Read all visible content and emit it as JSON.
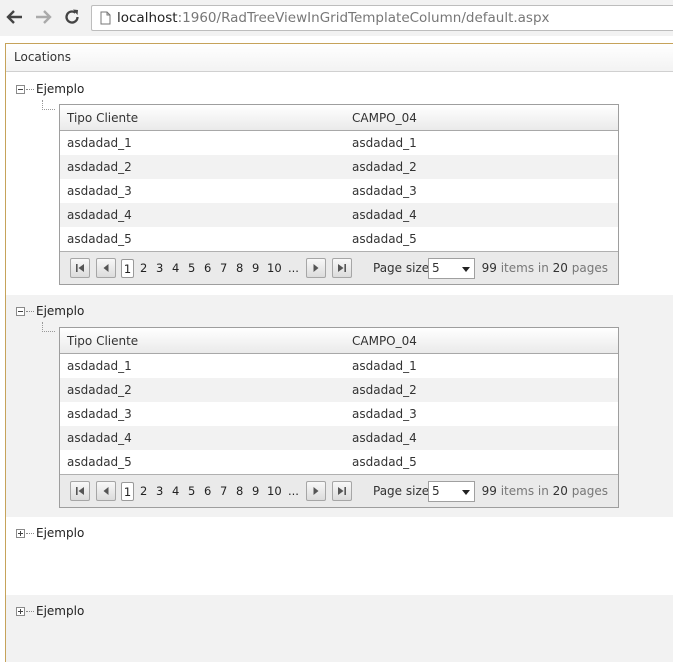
{
  "browser": {
    "url_host": "localhost",
    "url_rest": ":1960/RadTreeViewInGridTemplateColumn/default.aspx"
  },
  "outer_grid": {
    "header": "Locations"
  },
  "rows": [
    {
      "node_label": "Ejemplo",
      "expanded": true,
      "grid": {
        "columns": [
          "Tipo Cliente",
          "CAMPO_04"
        ],
        "rows": [
          [
            "asdadad_1",
            "asdadad_1"
          ],
          [
            "asdadad_2",
            "asdadad_2"
          ],
          [
            "asdadad_3",
            "asdadad_3"
          ],
          [
            "asdadad_4",
            "asdadad_4"
          ],
          [
            "asdadad_5",
            "asdadad_5"
          ]
        ],
        "pager": {
          "pages": [
            "1",
            "2",
            "3",
            "4",
            "5",
            "6",
            "7",
            "8",
            "9",
            "10",
            "..."
          ],
          "current_page": "1",
          "page_size_label": "Page size:",
          "page_size_value": "5",
          "items_count": "99",
          "items_text": "items in",
          "pages_count": "20",
          "pages_text": "pages"
        }
      }
    },
    {
      "node_label": "Ejemplo",
      "expanded": true,
      "grid": {
        "columns": [
          "Tipo Cliente",
          "CAMPO_04"
        ],
        "rows": [
          [
            "asdadad_1",
            "asdadad_1"
          ],
          [
            "asdadad_2",
            "asdadad_2"
          ],
          [
            "asdadad_3",
            "asdadad_3"
          ],
          [
            "asdadad_4",
            "asdadad_4"
          ],
          [
            "asdadad_5",
            "asdadad_5"
          ]
        ],
        "pager": {
          "pages": [
            "1",
            "2",
            "3",
            "4",
            "5",
            "6",
            "7",
            "8",
            "9",
            "10",
            "..."
          ],
          "current_page": "1",
          "page_size_label": "Page size:",
          "page_size_value": "5",
          "items_count": "99",
          "items_text": "items in",
          "pages_count": "20",
          "pages_text": "pages"
        }
      }
    },
    {
      "node_label": "Ejemplo",
      "expanded": false
    },
    {
      "node_label": "Ejemplo",
      "expanded": false
    }
  ],
  "colors": {
    "outer_border": "#c6a35a",
    "alt_row": "#f2f2f2"
  }
}
